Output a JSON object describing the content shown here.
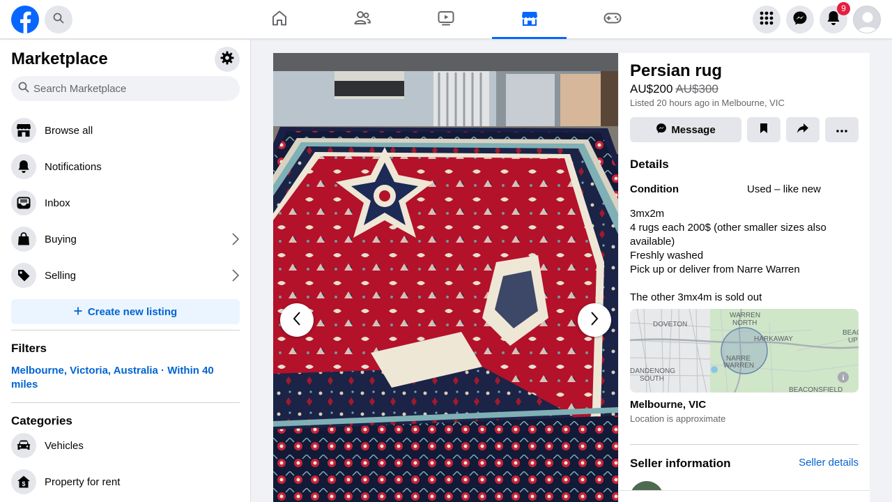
{
  "colors": {
    "brand_blue": "#0866ff",
    "link_blue": "#0064d1",
    "notification_red": "#e41e3f"
  },
  "topbar": {
    "logo_icon": "facebook-logo",
    "search_icon": "search-icon",
    "tabs": [
      {
        "name": "home",
        "icon": "home-icon",
        "active": false
      },
      {
        "name": "friends",
        "icon": "friends-icon",
        "active": false
      },
      {
        "name": "watch",
        "icon": "video-icon",
        "active": false
      },
      {
        "name": "marketplace",
        "icon": "marketplace-icon",
        "active": true
      },
      {
        "name": "gaming",
        "icon": "gamepad-icon",
        "active": false
      }
    ],
    "notifications_count": "9"
  },
  "sidebar": {
    "title": "Marketplace",
    "search_placeholder": "Search Marketplace",
    "items": [
      {
        "label": "Browse all",
        "icon": "storefront-icon"
      },
      {
        "label": "Notifications",
        "icon": "bell-icon"
      },
      {
        "label": "Inbox",
        "icon": "inbox-icon"
      },
      {
        "label": "Buying",
        "icon": "shopping-bag-icon"
      },
      {
        "label": "Selling",
        "icon": "price-tag-icon"
      }
    ],
    "create_listing_label": "Create new listing",
    "filters_heading": "Filters",
    "filter_location": "Melbourne, Victoria, Australia · Within 40 miles",
    "categories_heading": "Categories",
    "categories": [
      {
        "label": "Vehicles",
        "icon": "car-icon"
      },
      {
        "label": "Property for rent",
        "icon": "house-dollar-icon"
      }
    ]
  },
  "listing": {
    "title": "Persian rug",
    "price": "AU$200",
    "original_price": "AU$300",
    "listed": "Listed 20 hours ago in Melbourne, VIC",
    "message_label": "Message",
    "details_heading": "Details",
    "condition_label": "Condition",
    "condition_value": "Used – like new",
    "description_lines": [
      "3mx2m",
      "4 rugs each 200$ (other smaller sizes also available)",
      "Freshly washed",
      "Pick up or deliver from Narre Warren",
      "",
      "The other 3mx4m is sold out"
    ],
    "map_labels": [
      "DOVETON",
      "WARREN NORTH",
      "HARKAWAY",
      "NARRE WARREN",
      "DANDENONG SOUTH",
      "BEACONSFIELD",
      "BEACON UP"
    ],
    "location_title": "Melbourne, VIC",
    "location_note": "Location is approximate",
    "seller_heading": "Seller information",
    "seller_link": "Seller details"
  }
}
